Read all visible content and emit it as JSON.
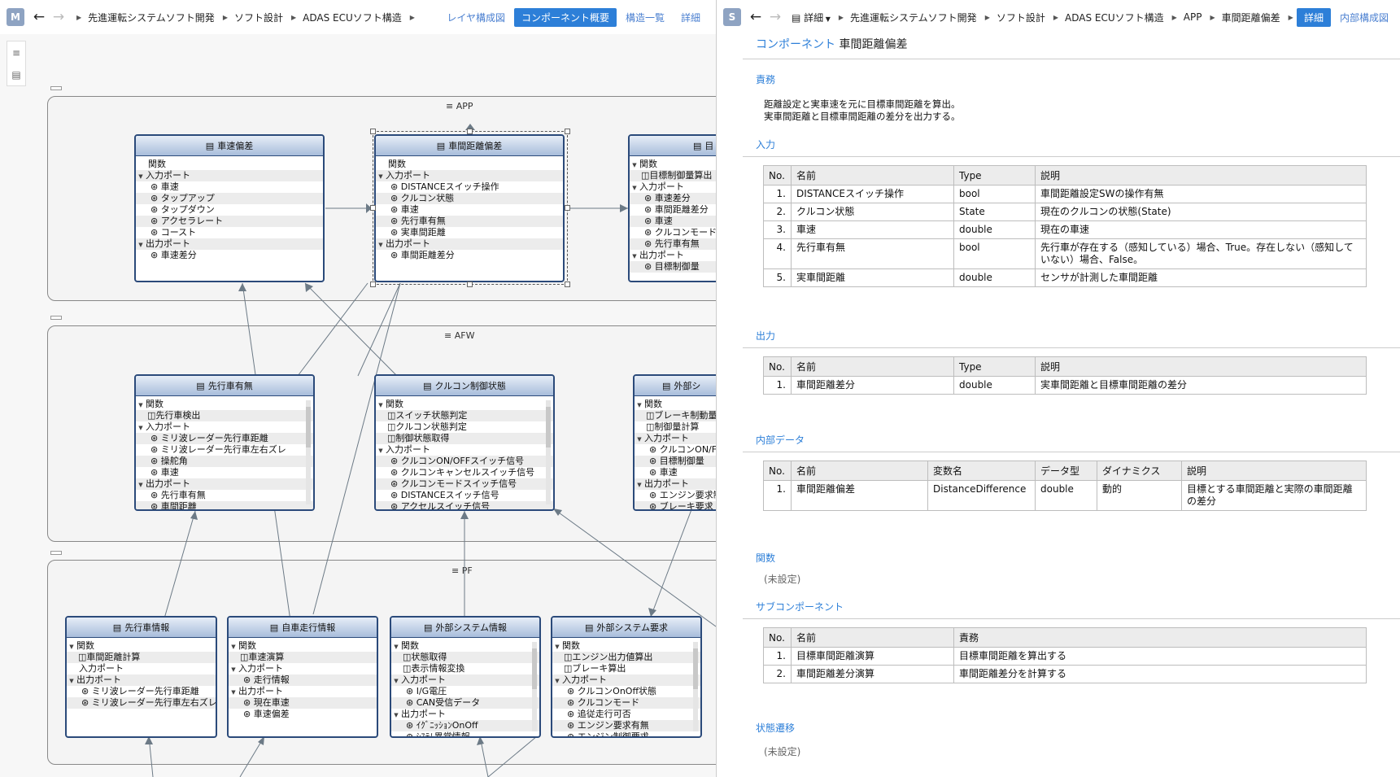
{
  "left_pane": {
    "letter": "M",
    "breadcrumb": [
      "先進運転システムソフト開発",
      "ソフト設計",
      "ADAS ECUソフト構造"
    ],
    "tabs": [
      "レイヤ構成図",
      "コンポーネント概要",
      "構造一覧",
      "詳細"
    ],
    "active_tab": 1,
    "layers": [
      {
        "name": "APP",
        "components": [
          {
            "title": "車速偏差",
            "rows": [
              "関数",
              "入力ポート",
              "車速",
              "タップアップ",
              "タップダウン",
              "アクセラレート",
              "コースト",
              "出力ポート",
              "車速差分"
            ]
          },
          {
            "title": "車間距離偏差",
            "rows": [
              "関数",
              "入力ポート",
              "DISTANCEスイッチ操作",
              "クルコン状態",
              "車速",
              "先行車有無",
              "実車間距離",
              "出力ポート",
              "車間距離差分"
            ]
          },
          {
            "title": "目",
            "rows": [
              "関数",
              "目標制御量算出",
              "入力ポート",
              "車速差分",
              "車間距離差分",
              "車速",
              "クルコンモード",
              "先行車有無",
              "出力ポート",
              "目標制御量"
            ]
          }
        ]
      },
      {
        "name": "AFW",
        "components": [
          {
            "title": "先行車有無",
            "rows": [
              "関数",
              "先行車検出",
              "入力ポート",
              "ミリ波レーダー先行車距離",
              "ミリ波レーダー先行車左右ズレ",
              "操舵角",
              "車速",
              "出力ポート",
              "先行車有無",
              "車間距離"
            ]
          },
          {
            "title": "クルコン制御状態",
            "rows": [
              "関数",
              "スイッチ状態判定",
              "クルコン状態判定",
              "制御状態取得",
              "入力ポート",
              "クルコンON/OFFスイッチ信号",
              "クルコンキャンセルスイッチ信号",
              "クルコンモードスイッチ信号",
              "DISTANCEスイッチ信号",
              "アクセルスイッチ信号"
            ]
          },
          {
            "title": "外部シ",
            "rows": [
              "関数",
              "ブレーキ制動量",
              "制御量計算",
              "入力ポート",
              "クルコンON/F",
              "目標制御量",
              "車速",
              "出力ポート",
              "エンジン要求制",
              "ブレーキ要求"
            ]
          }
        ]
      },
      {
        "name": "PF",
        "components": [
          {
            "title": "先行車情報",
            "rows": [
              "関数",
              "車間距離計算",
              "入力ポート",
              "出力ポート",
              "ミリ波レーダー先行車距離",
              "ミリ波レーダー先行車左右ズレ"
            ]
          },
          {
            "title": "自車走行情報",
            "rows": [
              "関数",
              "車速演算",
              "入力ポート",
              "走行情報",
              "出力ポート",
              "現在車速",
              "車速偏差"
            ]
          },
          {
            "title": "外部システム情報",
            "rows": [
              "関数",
              "状態取得",
              "表示情報変換",
              "入力ポート",
              "I/G電圧",
              "CAN受信データ",
              "出力ポート",
              "ｲｸﾞﾆｯｼｮﾝOnOff",
              "ｼｽﾃﾑ異常情報"
            ]
          },
          {
            "title": "外部システム要求",
            "rows": [
              "関数",
              "エンジン出力値算出",
              "ブレーキ算出",
              "入力ポート",
              "クルコンOnOff状態",
              "クルコンモード",
              "追従走行可否",
              "エンジン要求有無",
              "エンジン制御要求"
            ]
          }
        ]
      }
    ]
  },
  "right_pane": {
    "letter": "S",
    "detail_menu": "詳細",
    "breadcrumb": [
      "先進運転システムソフト開発",
      "ソフト設計",
      "ADAS ECUソフト構造",
      "APP",
      "車間距離偏差"
    ],
    "tabs": [
      "詳細",
      "内部構成図"
    ],
    "active_tab": 0,
    "title_prefix": "コンポーネント",
    "title": "車間距離偏差",
    "sections": {
      "responsibility": "責務",
      "inputs": "入力",
      "outputs": "出力",
      "internal": "内部データ",
      "functions": "関数",
      "subcomponents": "サブコンポーネント",
      "state_transition": "状態遷移"
    },
    "responsibility_lines": [
      "距離設定と実車速を元に目標車間距離を算出。",
      "実車間距離と目標車間距離の差分を出力する。"
    ],
    "io_headers": [
      "No.",
      "名前",
      "Type",
      "説明"
    ],
    "inputs": [
      [
        "1.",
        "DISTANCEスイッチ操作",
        "bool",
        "車間距離設定SWの操作有無"
      ],
      [
        "2.",
        "クルコン状態",
        "State",
        "現在のクルコンの状態(State)"
      ],
      [
        "3.",
        "車速",
        "double",
        "現在の車速"
      ],
      [
        "4.",
        "先行車有無",
        "bool",
        "先行車が存在する（感知している）場合、True。存在しない（感知していない）場合、False。"
      ],
      [
        "5.",
        "実車間距離",
        "double",
        "センサが計測した車間距離"
      ]
    ],
    "outputs": [
      [
        "1.",
        "車間距離差分",
        "double",
        "実車間距離と目標車間距離の差分"
      ]
    ],
    "internal_headers": [
      "No.",
      "名前",
      "変数名",
      "データ型",
      "ダイナミクス",
      "説明"
    ],
    "internal": [
      [
        "1.",
        "車間距離偏差",
        "DistanceDifference",
        "double",
        "動的",
        "目標とする車間距離と実際の車間距離の差分"
      ]
    ],
    "functions_value": "(未設定)",
    "sub_headers": [
      "No.",
      "名前",
      "責務"
    ],
    "subcomponents": [
      [
        "1.",
        "目標車間距離演算",
        "目標車間距離を算出する"
      ],
      [
        "2.",
        "車間距離差分演算",
        "車間距離差分を計算する"
      ]
    ],
    "state_value": "(未設定)"
  }
}
